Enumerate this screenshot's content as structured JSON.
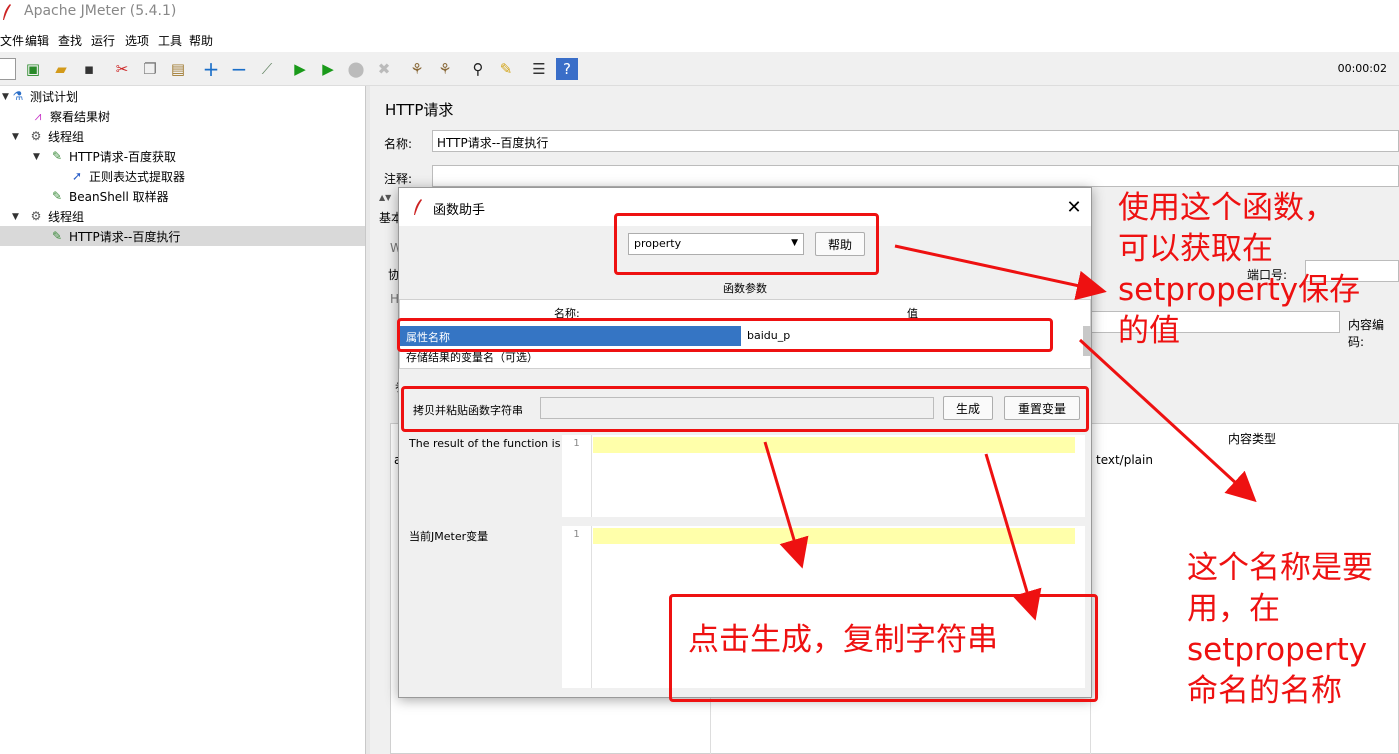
{
  "window": {
    "title": "Apache JMeter (5.4.1)"
  },
  "menu": [
    "文件",
    "编辑",
    "查找",
    "运行",
    "选项",
    "工具",
    "帮助"
  ],
  "timer": "00:00:02",
  "tree": [
    {
      "label": "测试计划",
      "icon": "flask-icon"
    },
    {
      "label": "察看结果树",
      "icon": "chart-icon"
    },
    {
      "label": "线程组",
      "icon": "gear-icon"
    },
    {
      "label": "HTTP请求-百度获取",
      "icon": "pipette-icon"
    },
    {
      "label": "正则表达式提取器",
      "icon": "extractor-icon"
    },
    {
      "label": "BeanShell 取样器",
      "icon": "pipette-icon"
    },
    {
      "label": "线程组",
      "icon": "gear-icon"
    },
    {
      "label": "HTTP请求--百度执行",
      "icon": "pipette-icon"
    }
  ],
  "panel": {
    "title": "HTTP请求",
    "name_label": "名称:",
    "name_value": "HTTP请求--百度执行",
    "comment_label": "注释:",
    "tab_basic": "基本",
    "w_label": "W",
    "xie_label": "协",
    "h_label": "H",
    "port_label": "端口号:",
    "content_encoding_label": "内容编码:",
    "can_label": "参",
    "a_label": "a",
    "content_type_header": "内容类型",
    "content_type_value": "text/plain"
  },
  "dialog": {
    "title": "函数助手",
    "function_select": "property",
    "help_button": "帮助",
    "params_title": "函数参数",
    "col_name": "名称:",
    "col_value": "值",
    "rows": [
      {
        "name": "属性名称",
        "value": "baidu_p"
      },
      {
        "name": "存储结果的变量名（可选）",
        "value": ""
      }
    ],
    "copy_label": "拷贝并粘贴函数字符串",
    "copy_value": "",
    "generate_button": "生成",
    "reset_button": "重置变量",
    "result_label": "The result of the function is",
    "result_line": "1",
    "vars_label": "当前JMeter变量",
    "vars_line": "1"
  },
  "annotations": {
    "top_right": [
      "使用这个函数，",
      "可以获取在",
      "setproperty保存",
      "的值"
    ],
    "bottom_right": [
      "这个名称是要",
      "用，在",
      "setproperty",
      "命名的名称"
    ],
    "bottom_center": "点击生成，复制字符串"
  },
  "colors": {
    "annotation": "#ee1111",
    "selection": "#3575c4",
    "highlight": "#ffffaa"
  }
}
